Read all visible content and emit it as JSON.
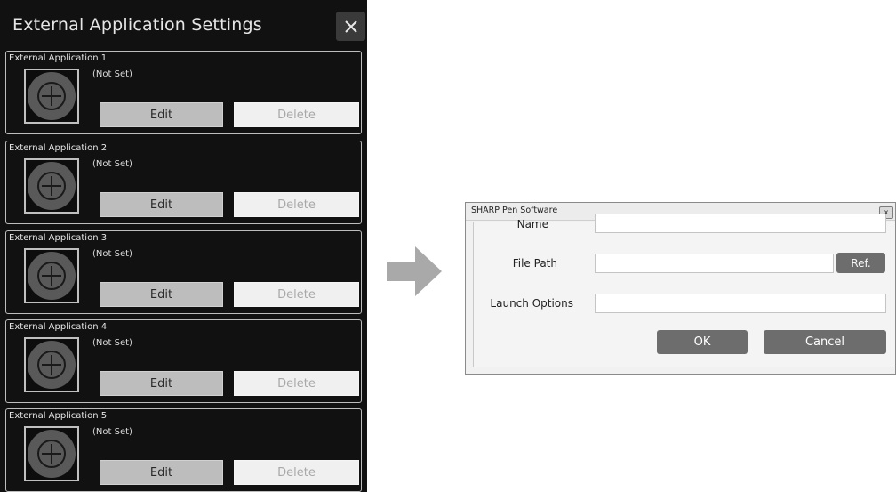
{
  "settings_panel": {
    "title": "External Application Settings",
    "close_icon": "close-x-icon",
    "slots": [
      {
        "label": "External Application 1",
        "status": "(Not Set)",
        "edit": "Edit",
        "delete": "Delete"
      },
      {
        "label": "External Application 2",
        "status": "(Not Set)",
        "edit": "Edit",
        "delete": "Delete"
      },
      {
        "label": "External Application 3",
        "status": "(Not Set)",
        "edit": "Edit",
        "delete": "Delete"
      },
      {
        "label": "External Application 4",
        "status": "(Not Set)",
        "edit": "Edit",
        "delete": "Delete"
      },
      {
        "label": "External Application 5",
        "status": "(Not Set)",
        "edit": "Edit",
        "delete": "Delete"
      }
    ],
    "add_icon": "plus-circle-icon"
  },
  "arrow_icon": "arrow-right-icon",
  "dialog": {
    "title": "SHARP Pen Software",
    "close_label": "x",
    "fields": {
      "name_label": "Name",
      "name_value": "",
      "file_path_label": "File Path",
      "file_path_value": "",
      "launch_options_label": "Launch Options",
      "launch_options_value": ""
    },
    "ref_button": "Ref.",
    "ok_button": "OK",
    "cancel_button": "Cancel"
  },
  "colors": {
    "panel_bg": "#111111",
    "edit_button": "#bdbdbd",
    "delete_button": "#f0f0f0",
    "dialog_button": "#6d6d6d"
  }
}
